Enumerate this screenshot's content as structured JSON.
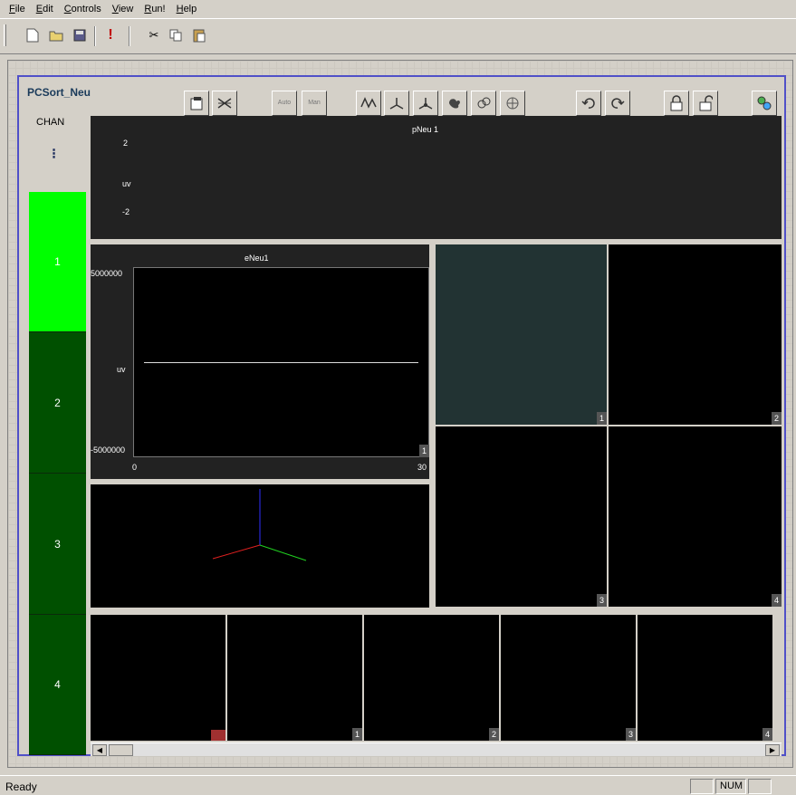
{
  "menu": [
    {
      "label": "File",
      "key": "F"
    },
    {
      "label": "Edit",
      "key": "E"
    },
    {
      "label": "Controls",
      "key": "C"
    },
    {
      "label": "View",
      "key": "V"
    },
    {
      "label": "Run!",
      "key": "R"
    },
    {
      "label": "Help",
      "key": "H"
    }
  ],
  "panel": {
    "title": "PCSort_Neu",
    "chan_label": "CHAN",
    "auto_label": "Auto",
    "man_label": "Man"
  },
  "channels": [
    "1",
    "2",
    "3",
    "4"
  ],
  "waveform_top": {
    "title": "pNeu 1",
    "y_top": "2",
    "y_unit": "uv",
    "y_bottom": "-2"
  },
  "energy_plot": {
    "title": "eNeu1",
    "y_max": "5000000",
    "y_unit": "uv",
    "y_min": "-5000000",
    "x_min": "0",
    "x_max": "30",
    "corner": "1"
  },
  "cluster_grid": [
    "1",
    "2",
    "3",
    "4"
  ],
  "bottom_strip": [
    "1",
    "2",
    "3",
    "4"
  ],
  "status": {
    "text": "Ready",
    "num": "NUM"
  },
  "colors": {
    "chan_active": "#00ff00",
    "chan_inactive": "#005000",
    "plot_bg": "#222222",
    "cluster_highlight": "#223333",
    "panel_border": "#5050c8"
  }
}
